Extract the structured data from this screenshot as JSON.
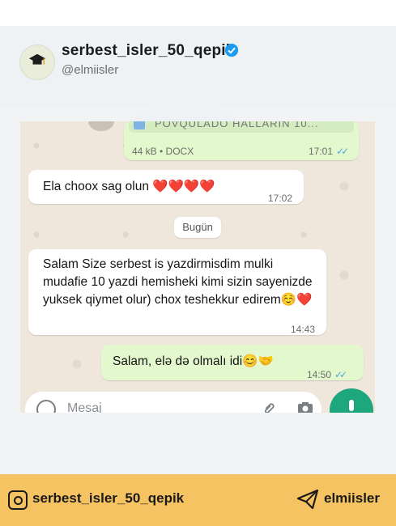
{
  "header": {
    "account_name": "serbest_isler_50_qepik",
    "handle": "@elmiisler"
  },
  "chat": {
    "document": {
      "name": "POVQULADO HALLARIN 10...",
      "meta": "44 kB • DOCX",
      "time": "17:01",
      "ticks": "✓✓"
    },
    "messages": [
      {
        "direction": "in",
        "text": "Ela choox sag olun ❤️❤️❤️❤️",
        "time": "17:02"
      },
      {
        "direction": "in",
        "text": "Salam Size serbest is yazdirmisdim mulki mudafie  10 yazdi hemisheki kimi sizin sayenizde yuksek qiymet olur) chox teshekkur edirem☺️❤️",
        "time": "14:43"
      },
      {
        "direction": "out",
        "text": "Salam, elə də olmalı idi😊🤝",
        "time": "14:50",
        "ticks": "✓✓"
      }
    ],
    "day_divider": "Bugün",
    "input_placeholder": "Mesaj"
  },
  "footer": {
    "instagram": "serbest_isler_50_qepik",
    "telegram": "elmiisler"
  },
  "colors": {
    "outgoing": "#e3f8cd",
    "incoming": "#ffffff",
    "accent": "#1ea67c",
    "footer": "#f6c363",
    "verified": "#1d9bf0"
  }
}
